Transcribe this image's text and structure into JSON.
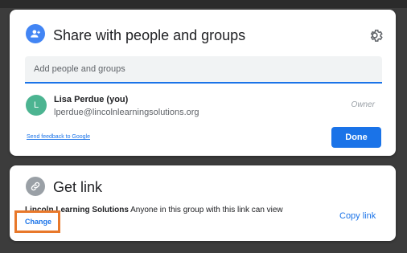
{
  "share_dialog": {
    "title": "Share with people and groups",
    "search_placeholder": "Add people and groups",
    "user": {
      "initial": "L",
      "name": "Lisa Perdue (you)",
      "email": "lperdue@lincolnlearningsolutions.org",
      "role": "Owner"
    },
    "feedback_link": "Send feedback to Google",
    "done_label": "Done"
  },
  "get_link": {
    "title": "Get link",
    "group_name": "Lincoln Learning Solutions",
    "description": " Anyone in this group with this link can view",
    "change_label": "Change",
    "copy_link_label": "Copy link"
  },
  "colors": {
    "accent": "#1a73e8",
    "share_icon_bg": "#4285f4",
    "link_icon_bg": "#9aa0a6",
    "avatar_bg": "#4cb491",
    "highlight": "#e8782a"
  }
}
